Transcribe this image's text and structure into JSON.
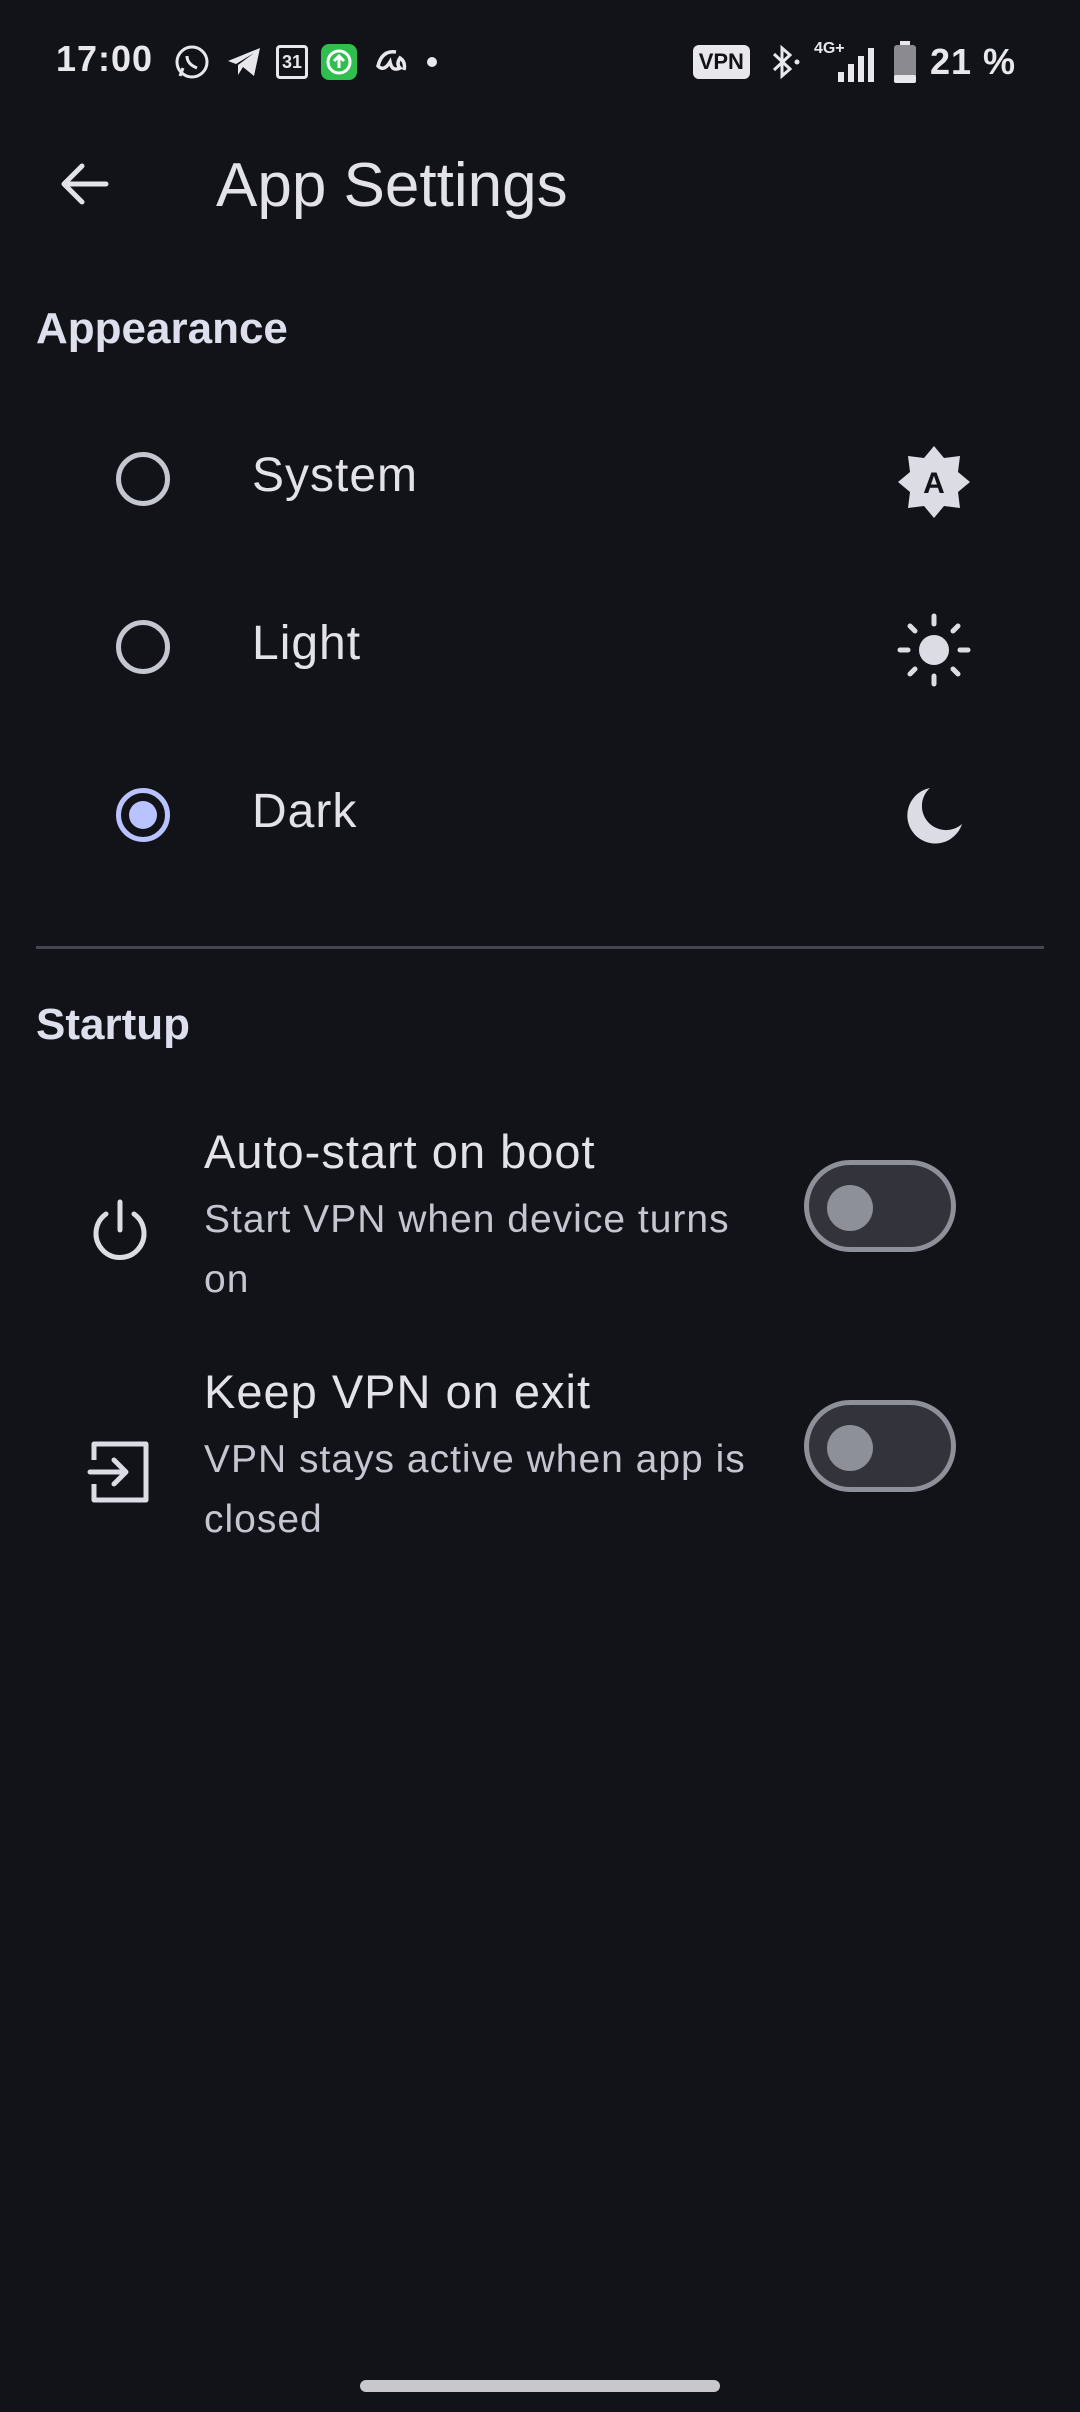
{
  "status_bar": {
    "time": "17:00",
    "calendar_day": "31",
    "vpn_label": "VPN",
    "network_label": "4G+",
    "battery_percent": "21 %",
    "notification_icons": [
      "whatsapp-icon",
      "telegram-icon",
      "calendar-icon",
      "upload-icon",
      "app-icon",
      "dot-icon"
    ]
  },
  "top_bar": {
    "title": "App Settings"
  },
  "appearance": {
    "header": "Appearance",
    "options": [
      {
        "label": "System",
        "selected": false,
        "icon": "auto-brightness-icon"
      },
      {
        "label": "Light",
        "selected": false,
        "icon": "sun-icon"
      },
      {
        "label": "Dark",
        "selected": true,
        "icon": "moon-icon"
      }
    ]
  },
  "startup": {
    "header": "Startup",
    "settings": [
      {
        "title": "Auto-start on boot",
        "subtitle": "Start VPN when device turns on",
        "enabled": false,
        "icon": "power-icon"
      },
      {
        "title": "Keep VPN on exit",
        "subtitle": "VPN stays active when app is closed",
        "enabled": false,
        "icon": "exit-icon"
      }
    ]
  },
  "colors": {
    "background": "#121318",
    "accent": "#b8c3ff",
    "text_primary": "#e3e2e9",
    "text_secondary": "#c4c6d0"
  }
}
